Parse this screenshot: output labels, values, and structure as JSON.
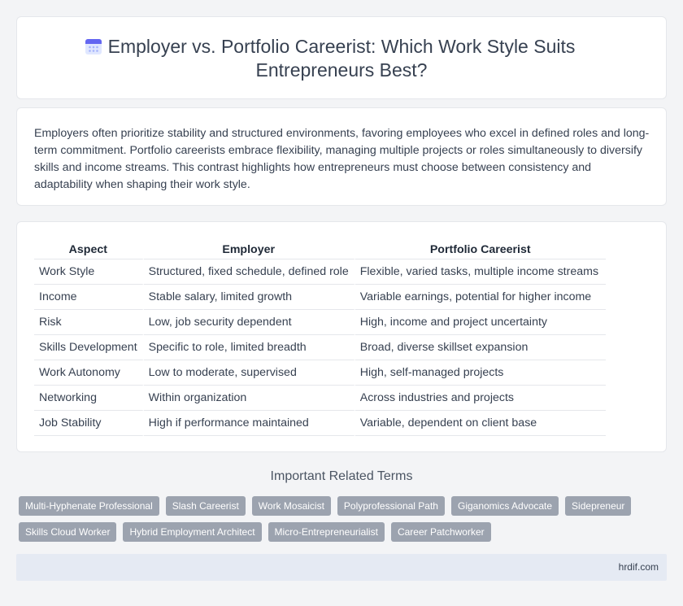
{
  "header": {
    "title": "Employer vs. Portfolio Careerist: Which Work Style Suits Entrepreneurs Best?",
    "icon": "calendar-icon"
  },
  "intro": {
    "text": "Employers often prioritize stability and structured environments, favoring employees who excel in defined roles and long-term commitment. Portfolio careerists embrace flexibility, managing multiple projects or roles simultaneously to diversify skills and income streams. This contrast highlights how entrepreneurs must choose between consistency and adaptability when shaping their work style."
  },
  "comparison": {
    "headers": [
      "Aspect",
      "Employer",
      "Portfolio Careerist"
    ],
    "rows": [
      [
        "Work Style",
        "Structured, fixed schedule, defined role",
        "Flexible, varied tasks, multiple income streams"
      ],
      [
        "Income",
        "Stable salary, limited growth",
        "Variable earnings, potential for higher income"
      ],
      [
        "Risk",
        "Low, job security dependent",
        "High, income and project uncertainty"
      ],
      [
        "Skills Development",
        "Specific to role, limited breadth",
        "Broad, diverse skillset expansion"
      ],
      [
        "Work Autonomy",
        "Low to moderate, supervised",
        "High, self-managed projects"
      ],
      [
        "Networking",
        "Within organization",
        "Across industries and projects"
      ],
      [
        "Job Stability",
        "High if performance maintained",
        "Variable, dependent on client base"
      ]
    ]
  },
  "related": {
    "title": "Important Related Terms",
    "terms": [
      "Multi-Hyphenate Professional",
      "Slash Careerist",
      "Work Mosaicist",
      "Polyprofessional Path",
      "Giganomics Advocate",
      "Sidepreneur",
      "Skills Cloud Worker",
      "Hybrid Employment Architect",
      "Micro-Entrepreneurialist",
      "Career Patchworker"
    ]
  },
  "footer": {
    "site": "hrdif.com"
  }
}
